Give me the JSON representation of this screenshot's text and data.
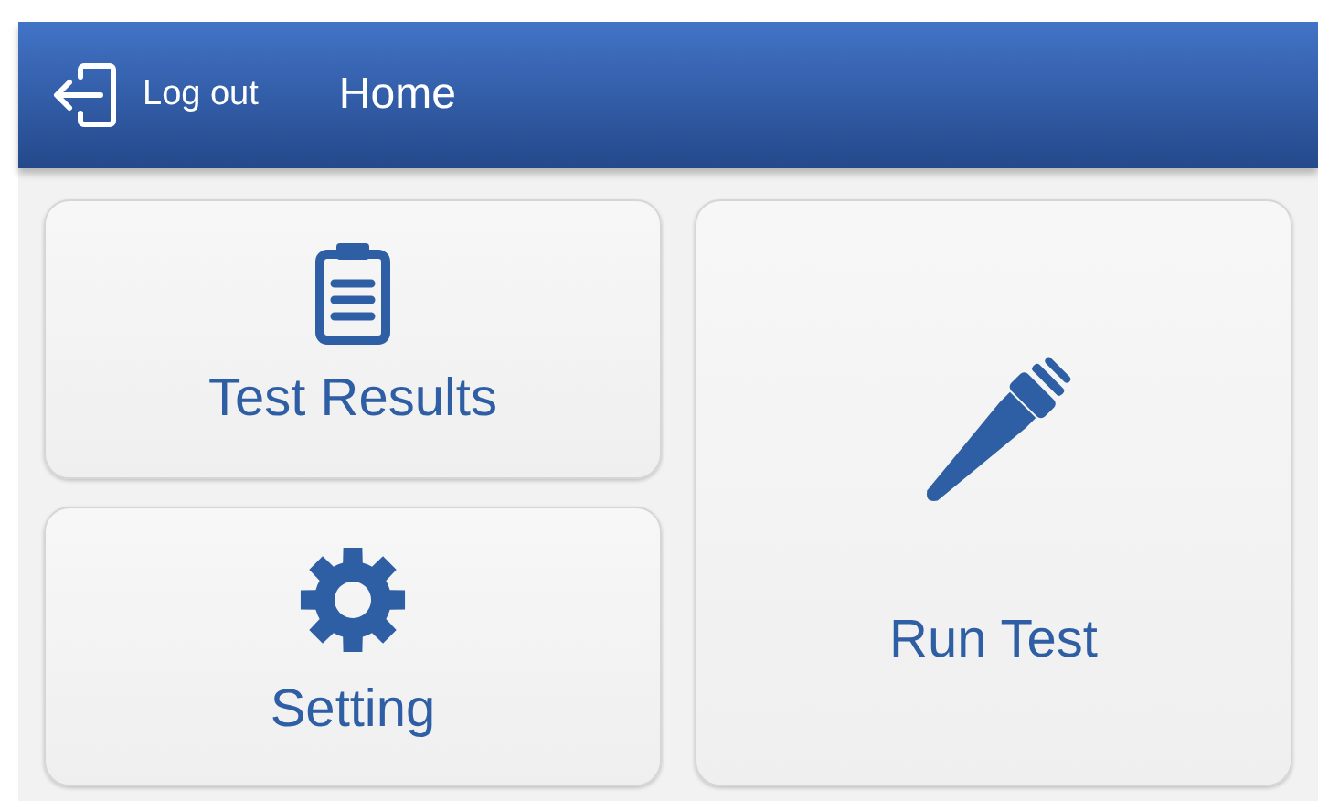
{
  "header": {
    "logout_label": "Log out",
    "title": "Home"
  },
  "tiles": [
    {
      "label": "Test Results"
    },
    {
      "label": "Setting"
    },
    {
      "label": "Run Test"
    }
  ]
}
